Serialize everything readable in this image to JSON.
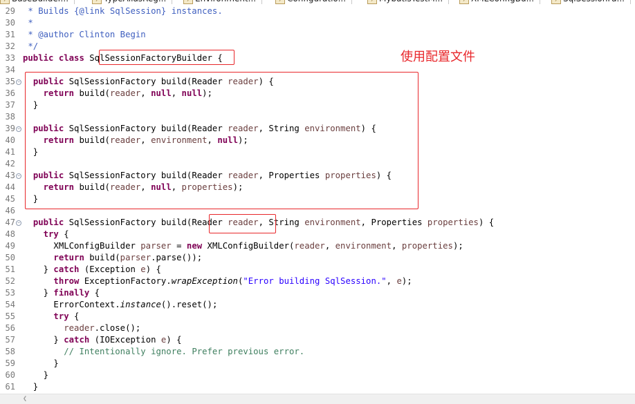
{
  "tabs": [
    {
      "label": "BaseBuilder...",
      "icon": "java-file-icon"
    },
    {
      "label": "TypeAliasReg...",
      "icon": "java-file-icon"
    },
    {
      "label": "Environment...",
      "icon": "java-file-icon"
    },
    {
      "label": "Configuratio...",
      "icon": "java-file-icon"
    },
    {
      "label": "MybatisTestM...",
      "icon": "java-file-icon"
    },
    {
      "label": "XMLConfigBu...",
      "icon": "java-file-icon"
    },
    {
      "label": "SqlSessionFa...",
      "icon": "java-file-icon"
    }
  ],
  "annotation": {
    "text": "使用配置文件",
    "color": "#e8262a"
  },
  "editor": {
    "lines": [
      {
        "n": "29",
        "fold": false,
        "segs": [
          [
            "cm",
            " * Builds {@link SqlSession} instances."
          ]
        ]
      },
      {
        "n": "30",
        "fold": false,
        "segs": [
          [
            "cm",
            " *"
          ]
        ]
      },
      {
        "n": "31",
        "fold": false,
        "segs": [
          [
            "cm",
            " * @author Clinton Begin"
          ]
        ]
      },
      {
        "n": "32",
        "fold": false,
        "segs": [
          [
            "cm",
            " */"
          ]
        ]
      },
      {
        "n": "33",
        "fold": false,
        "segs": [
          [
            "kw",
            "public"
          ],
          [
            "p",
            " "
          ],
          [
            "kw",
            "class"
          ],
          [
            "p",
            " SqlSessionFactoryBuilder {"
          ]
        ]
      },
      {
        "n": "34",
        "fold": false,
        "segs": []
      },
      {
        "n": "35",
        "fold": true,
        "segs": [
          [
            "p",
            "  "
          ],
          [
            "kw",
            "public"
          ],
          [
            "p",
            " SqlSessionFactory build(Reader "
          ],
          [
            "fld",
            "reader"
          ],
          [
            "p",
            ") {"
          ]
        ]
      },
      {
        "n": "36",
        "fold": false,
        "segs": [
          [
            "p",
            "    "
          ],
          [
            "kw",
            "return"
          ],
          [
            "p",
            " build("
          ],
          [
            "fld",
            "reader"
          ],
          [
            "p",
            ", "
          ],
          [
            "kw",
            "null"
          ],
          [
            "p",
            ", "
          ],
          [
            "kw",
            "null"
          ],
          [
            "p",
            ");"
          ]
        ]
      },
      {
        "n": "37",
        "fold": false,
        "segs": [
          [
            "p",
            "  }"
          ]
        ]
      },
      {
        "n": "38",
        "fold": false,
        "segs": []
      },
      {
        "n": "39",
        "fold": true,
        "segs": [
          [
            "p",
            "  "
          ],
          [
            "kw",
            "public"
          ],
          [
            "p",
            " SqlSessionFactory build(Reader "
          ],
          [
            "fld",
            "reader"
          ],
          [
            "p",
            ", String "
          ],
          [
            "fld",
            "environment"
          ],
          [
            "p",
            ") {"
          ]
        ]
      },
      {
        "n": "40",
        "fold": false,
        "segs": [
          [
            "p",
            "    "
          ],
          [
            "kw",
            "return"
          ],
          [
            "p",
            " build("
          ],
          [
            "fld",
            "reader"
          ],
          [
            "p",
            ", "
          ],
          [
            "fld",
            "environment"
          ],
          [
            "p",
            ", "
          ],
          [
            "kw",
            "null"
          ],
          [
            "p",
            ");"
          ]
        ]
      },
      {
        "n": "41",
        "fold": false,
        "segs": [
          [
            "p",
            "  }"
          ]
        ]
      },
      {
        "n": "42",
        "fold": false,
        "segs": []
      },
      {
        "n": "43",
        "fold": true,
        "segs": [
          [
            "p",
            "  "
          ],
          [
            "kw",
            "public"
          ],
          [
            "p",
            " SqlSessionFactory build(Reader "
          ],
          [
            "fld",
            "reader"
          ],
          [
            "p",
            ", Properties "
          ],
          [
            "fld",
            "properties"
          ],
          [
            "p",
            ") {"
          ]
        ]
      },
      {
        "n": "44",
        "fold": false,
        "segs": [
          [
            "p",
            "    "
          ],
          [
            "kw",
            "return"
          ],
          [
            "p",
            " build("
          ],
          [
            "fld",
            "reader"
          ],
          [
            "p",
            ", "
          ],
          [
            "kw",
            "null"
          ],
          [
            "p",
            ", "
          ],
          [
            "fld",
            "properties"
          ],
          [
            "p",
            ");"
          ]
        ]
      },
      {
        "n": "45",
        "fold": false,
        "segs": [
          [
            "p",
            "  }"
          ]
        ]
      },
      {
        "n": "46",
        "fold": false,
        "segs": []
      },
      {
        "n": "47",
        "fold": true,
        "segs": [
          [
            "p",
            "  "
          ],
          [
            "kw",
            "public"
          ],
          [
            "p",
            " SqlSessionFactory build(Reader "
          ],
          [
            "fld",
            "reader"
          ],
          [
            "p",
            ", String "
          ],
          [
            "fld",
            "environment"
          ],
          [
            "p",
            ", Properties "
          ],
          [
            "fld",
            "properties"
          ],
          [
            "p",
            ") {"
          ]
        ]
      },
      {
        "n": "48",
        "fold": false,
        "segs": [
          [
            "p",
            "    "
          ],
          [
            "kw",
            "try"
          ],
          [
            "p",
            " {"
          ]
        ]
      },
      {
        "n": "49",
        "fold": false,
        "segs": [
          [
            "p",
            "      XMLConfigBuilder "
          ],
          [
            "fld",
            "parser"
          ],
          [
            "p",
            " = "
          ],
          [
            "kw",
            "new"
          ],
          [
            "p",
            " XMLConfigBuilder("
          ],
          [
            "fld",
            "reader"
          ],
          [
            "p",
            ", "
          ],
          [
            "fld",
            "environment"
          ],
          [
            "p",
            ", "
          ],
          [
            "fld",
            "properties"
          ],
          [
            "p",
            ");"
          ]
        ]
      },
      {
        "n": "50",
        "fold": false,
        "segs": [
          [
            "p",
            "      "
          ],
          [
            "kw",
            "return"
          ],
          [
            "p",
            " build("
          ],
          [
            "fld",
            "parser"
          ],
          [
            "p",
            ".parse());"
          ]
        ]
      },
      {
        "n": "51",
        "fold": false,
        "segs": [
          [
            "p",
            "    } "
          ],
          [
            "kw",
            "catch"
          ],
          [
            "p",
            " (Exception "
          ],
          [
            "fld",
            "e"
          ],
          [
            "p",
            ") {"
          ]
        ]
      },
      {
        "n": "52",
        "fold": false,
        "segs": [
          [
            "p",
            "      "
          ],
          [
            "kw",
            "throw"
          ],
          [
            "p",
            " ExceptionFactory."
          ],
          [
            "it",
            "wrapException"
          ],
          [
            "p",
            "("
          ],
          [
            "str",
            "\"Error building SqlSession.\""
          ],
          [
            "p",
            ", "
          ],
          [
            "fld",
            "e"
          ],
          [
            "p",
            ");"
          ]
        ]
      },
      {
        "n": "53",
        "fold": false,
        "segs": [
          [
            "p",
            "    } "
          ],
          [
            "kw",
            "finally"
          ],
          [
            "p",
            " {"
          ]
        ]
      },
      {
        "n": "54",
        "fold": false,
        "segs": [
          [
            "p",
            "      ErrorContext."
          ],
          [
            "it",
            "instance"
          ],
          [
            "p",
            "().reset();"
          ]
        ]
      },
      {
        "n": "55",
        "fold": false,
        "segs": [
          [
            "p",
            "      "
          ],
          [
            "kw",
            "try"
          ],
          [
            "p",
            " {"
          ]
        ]
      },
      {
        "n": "56",
        "fold": false,
        "segs": [
          [
            "p",
            "        "
          ],
          [
            "fld",
            "reader"
          ],
          [
            "p",
            ".close();"
          ]
        ]
      },
      {
        "n": "57",
        "fold": false,
        "segs": [
          [
            "p",
            "      } "
          ],
          [
            "kw",
            "catch"
          ],
          [
            "p",
            " (IOException "
          ],
          [
            "fld",
            "e"
          ],
          [
            "p",
            ") {"
          ]
        ]
      },
      {
        "n": "58",
        "fold": false,
        "segs": [
          [
            "p",
            "        "
          ],
          [
            "lc",
            "// Intentionally ignore. Prefer previous error."
          ]
        ]
      },
      {
        "n": "59",
        "fold": false,
        "segs": [
          [
            "p",
            "      }"
          ]
        ]
      },
      {
        "n": "60",
        "fold": false,
        "segs": [
          [
            "p",
            "    }"
          ]
        ]
      },
      {
        "n": "61",
        "fold": false,
        "segs": [
          [
            "p",
            "  }"
          ]
        ]
      }
    ]
  }
}
